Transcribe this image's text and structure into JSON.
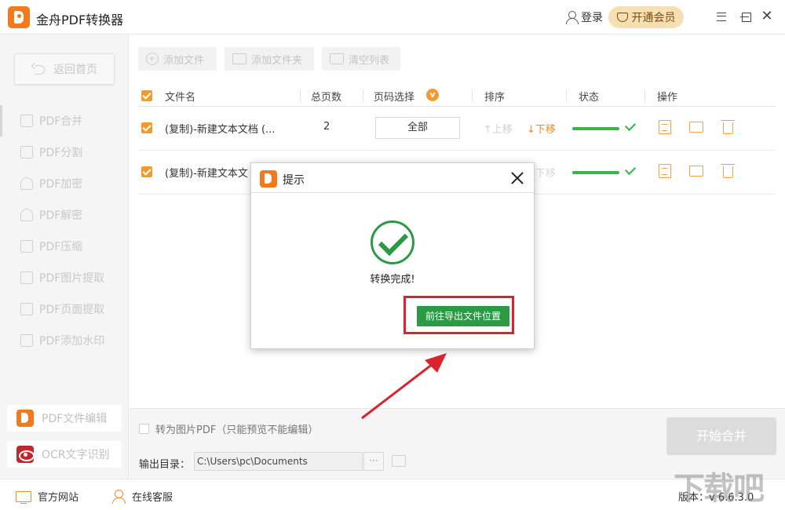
{
  "app": {
    "title": "金舟PDF转换器",
    "login_label": "登录",
    "vip_label": "开通会员"
  },
  "sidebar": {
    "back_label": "返回首页",
    "items": [
      {
        "label": "PDF合并"
      },
      {
        "label": "PDF分割"
      },
      {
        "label": "PDF加密"
      },
      {
        "label": "PDF解密"
      },
      {
        "label": "PDF压缩"
      },
      {
        "label": "PDF图片提取"
      },
      {
        "label": "PDF页面提取"
      },
      {
        "label": "PDF添加水印"
      }
    ],
    "tools": [
      {
        "label": "PDF文件编辑"
      },
      {
        "label": "OCR文字识别"
      }
    ]
  },
  "toolbar": {
    "add_file": "添加文件",
    "add_folder": "添加文件夹",
    "clear_list": "清空列表"
  },
  "table": {
    "headers": {
      "file_name": "文件名",
      "total_pages": "总页数",
      "page_select": "页码选择",
      "page_select_badge": "v",
      "sort": "排序",
      "status": "状态",
      "actions": "操作"
    },
    "rows": [
      {
        "file_name": "(复制)-新建文本文档 (...",
        "pages": "2",
        "range": "全部",
        "move_up": "↑上移",
        "move_down": "↓下移"
      },
      {
        "file_name": "(复制)-新建文本文",
        "pages": "",
        "range": "",
        "move_up": "",
        "move_down": "↓下移"
      }
    ]
  },
  "bottom": {
    "image_pdf_label": "转为图片PDF（只能预览不能编辑）",
    "output_label": "输出目录：",
    "output_path": "C:\\Users\\pc\\Documents",
    "browse_label": "···",
    "start_label": "开始合并"
  },
  "status_bar": {
    "website": "官方网站",
    "support": "在线客服",
    "version": "版本：v 6.6.3.0"
  },
  "dialog": {
    "title": "提示",
    "message": "转换完成!",
    "button": "前往导出文件位置"
  },
  "colors": {
    "accent_orange": "#f07a1c",
    "success_green": "#2c9a45",
    "highlight_red": "#d7262b"
  }
}
